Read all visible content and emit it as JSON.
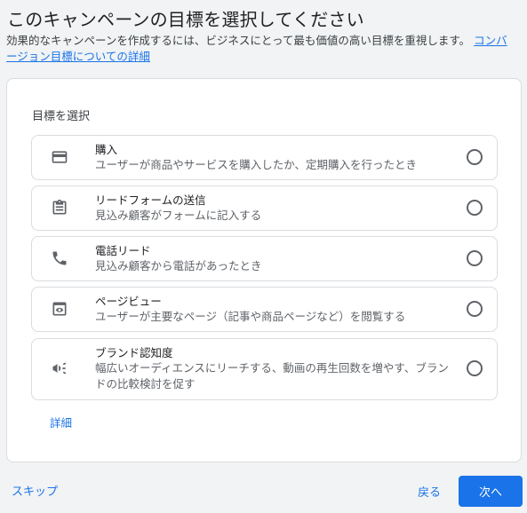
{
  "page": {
    "title": "このキャンペーンの目標を選択してください",
    "description": "効果的なキャンペーンを作成するには、ビジネスにとって最も価値の高い目標を重視します。",
    "description_link": "コンバージョン目標についての詳細"
  },
  "card": {
    "section_title": "目標を選択",
    "options": [
      {
        "icon": "credit-card-icon",
        "label": "購入",
        "desc": "ユーザーが商品やサービスを購入したか、定期購入を行ったとき",
        "selected": false
      },
      {
        "icon": "clipboard-icon",
        "label": "リードフォームの送信",
        "desc": "見込み顧客がフォームに記入する",
        "selected": false
      },
      {
        "icon": "phone-icon",
        "label": "電話リード",
        "desc": "見込み顧客から電話があったとき",
        "selected": false
      },
      {
        "icon": "page-view-icon",
        "label": "ページビュー",
        "desc": "ユーザーが主要なページ（記事や商品ページなど）を閲覧する",
        "selected": false
      },
      {
        "icon": "megaphone-icon",
        "label": "ブランド認知度",
        "desc": "幅広いオーディエンスにリーチする、動画の再生回数を増やす、ブランドの比較検討を促す",
        "selected": false
      }
    ],
    "details_link": "詳細"
  },
  "footer": {
    "skip_label": "スキップ",
    "back_label": "戻る",
    "next_label": "次へ"
  },
  "colors": {
    "accent": "#1a73e8",
    "background": "#f1f3f4",
    "card": "#ffffff",
    "border": "#dadce0"
  }
}
